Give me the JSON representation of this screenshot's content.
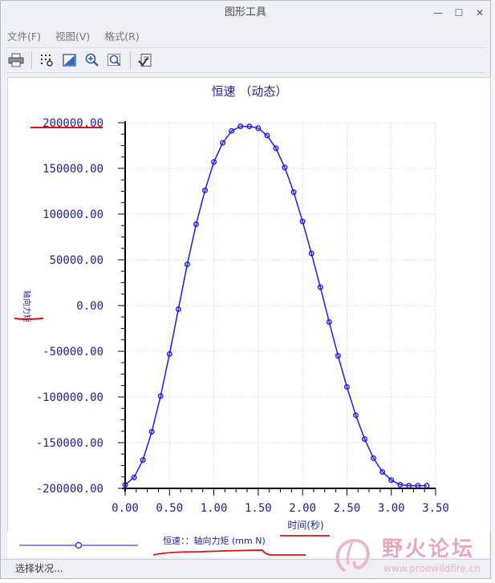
{
  "window": {
    "title": "图形工具",
    "buttons": [
      "—",
      "☐",
      "✕"
    ]
  },
  "menubar": {
    "items": [
      {
        "label": "文件(F)"
      },
      {
        "label": "视图(V)"
      },
      {
        "label": "格式(R)"
      }
    ]
  },
  "toolbar": {
    "items": [
      {
        "name": "print-icon"
      },
      {
        "name": "toggle-grid-icon"
      },
      {
        "name": "refit-icon"
      },
      {
        "name": "zoom-in-icon"
      },
      {
        "name": "zoom-out-icon"
      },
      {
        "name": "format-icon"
      }
    ]
  },
  "status": {
    "text": "选择状况..."
  },
  "watermark": {
    "cn": "野火论坛",
    "url": "www.proewildfire.cn"
  },
  "colors": {
    "curve": "#1a1aff",
    "axis_text": "#1f1f8f",
    "annotation": "#e01010"
  },
  "chart_data": {
    "type": "line",
    "title": "恒速 （动态）",
    "xlabel": "时间(秒)",
    "ylabel": "轴向力矩",
    "legend": "恒速：：轴向力矩 (mm N)",
    "xlim": [
      0,
      3.5
    ],
    "ylim": [
      -200000,
      200000
    ],
    "x_ticks": [
      "0.00",
      "0.50",
      "1.00",
      "1.50",
      "2.00",
      "2.50",
      "3.00",
      "3.50"
    ],
    "y_ticks": [
      "200000.00",
      "150000.00",
      "100000.00",
      "50000.00",
      "0.00",
      "-50000.00",
      "-100000.00",
      "-150000.00",
      "-200000.00"
    ],
    "grid": true,
    "series": [
      {
        "x": [
          0,
          0.1,
          0.2,
          0.3,
          0.4,
          0.5,
          0.6,
          0.7,
          0.8,
          0.9,
          1.0,
          1.1,
          1.2,
          1.3,
          1.4,
          1.5,
          1.6,
          1.7,
          1.8,
          1.9,
          2.0,
          2.1,
          2.2,
          2.3,
          2.4,
          2.5,
          2.6,
          2.7,
          2.8,
          2.9,
          3.0,
          3.1,
          3.2,
          3.3,
          3.4
        ],
        "y": [
          -196000,
          -188000,
          -169000,
          -138000,
          -99000,
          -53000,
          -4000,
          45000,
          89000,
          126000,
          157000,
          178000,
          191000,
          196000,
          196000,
          194000,
          186000,
          172000,
          151000,
          124000,
          92000,
          57000,
          20000,
          -18000,
          -55000,
          -89000,
          -120000,
          -146000,
          -167000,
          -182000,
          -191000,
          -196000,
          -197000,
          -197000,
          -197000
        ]
      }
    ]
  }
}
